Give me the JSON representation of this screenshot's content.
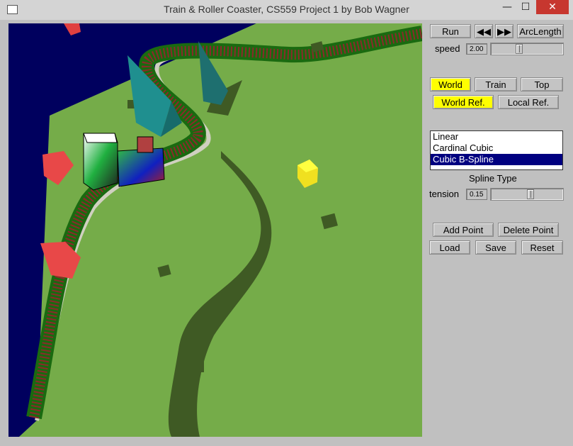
{
  "window": {
    "title": "Train & Roller Coaster, CS559 Project 1 by Bob Wagner",
    "min_glyph": "—",
    "max_glyph": "☐",
    "close_glyph": "✕"
  },
  "controls": {
    "run_label": "Run",
    "rewind_glyph": "◀◀",
    "forward_glyph": "▶▶",
    "arclength_label": "ArcLength",
    "speed_label": "speed",
    "speed_value": "2.00",
    "speed_fraction": 0.38,
    "view": {
      "world_label": "World",
      "train_label": "Train",
      "top_label": "Top",
      "selected": "World"
    },
    "ref": {
      "world_ref_label": "World Ref.",
      "local_ref_label": "Local Ref.",
      "selected": "World Ref."
    },
    "spline_list": {
      "items": [
        "Linear",
        "Cardinal Cubic",
        "Cubic B-Spline"
      ],
      "selected_index": 2,
      "caption": "Spline Type"
    },
    "tension_label": "tension",
    "tension_value": "0.15",
    "tension_fraction": 0.55,
    "add_point_label": "Add Point",
    "delete_point_label": "Delete Point",
    "load_label": "Load",
    "save_label": "Save",
    "reset_label": "Reset"
  },
  "colors": {
    "ground": "#75ac49",
    "sky": "#00005e",
    "highlight": "#ffff00",
    "list_selection": "#000080",
    "close_button": "#c7372f"
  }
}
